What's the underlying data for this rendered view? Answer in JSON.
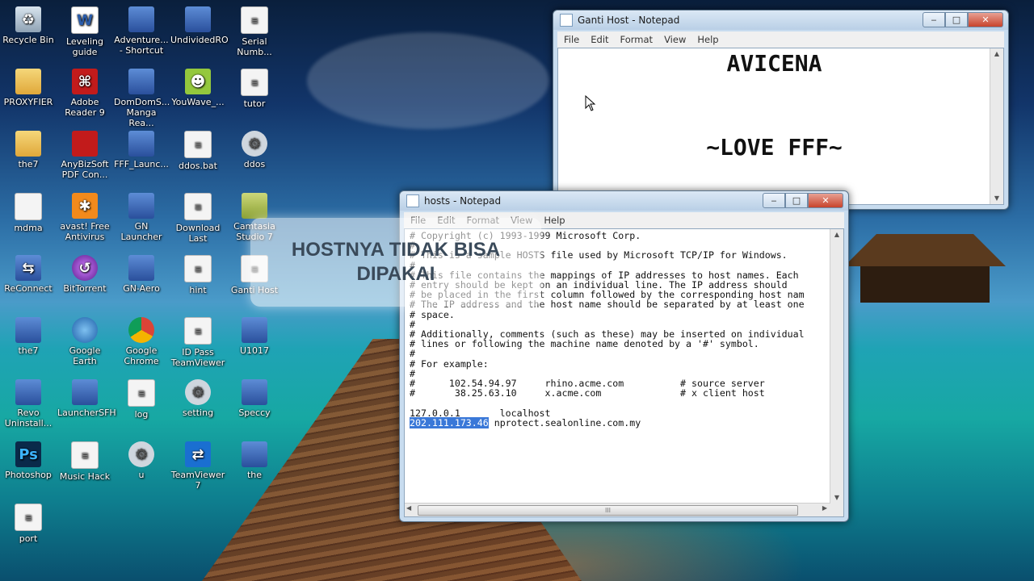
{
  "desktop": {
    "icons": [
      {
        "label": "Recycle Bin",
        "icon": "recycle-bin-icon"
      },
      {
        "label": "Leveling guide",
        "icon": "word-document-icon"
      },
      {
        "label": "Adventure... - Shortcut",
        "icon": "shortcut-icon"
      },
      {
        "label": "UndividedRO",
        "icon": "app-icon"
      },
      {
        "label": "Serial Numb...",
        "icon": "document-icon"
      },
      {
        "label": "PROXYFIER",
        "icon": "folder-icon"
      },
      {
        "label": "Adobe Reader 9",
        "icon": "pdf-icon"
      },
      {
        "label": "DomDomS... Manga Rea...",
        "icon": "app-icon"
      },
      {
        "label": "YouWave_...",
        "icon": "android-icon"
      },
      {
        "label": "tutor",
        "icon": "document-icon"
      },
      {
        "label": "the7",
        "icon": "folder-icon"
      },
      {
        "label": "AnyBizSoft PDF Con...",
        "icon": "pdf-converter-icon"
      },
      {
        "label": "FFF_Launc...",
        "icon": "app-icon"
      },
      {
        "label": "ddos.bat",
        "icon": "document-icon"
      },
      {
        "label": "ddos",
        "icon": "settings-icon"
      },
      {
        "label": "mdma",
        "icon": "usb-icon"
      },
      {
        "label": "avast! Free Antivirus",
        "icon": "avast-icon"
      },
      {
        "label": "GN Launcher",
        "icon": "app-icon"
      },
      {
        "label": "Download Last",
        "icon": "document-icon"
      },
      {
        "label": "Camtasia Studio 7",
        "icon": "camtasia-icon"
      },
      {
        "label": "ReConnect",
        "icon": "network-icon"
      },
      {
        "label": "BitTorrent",
        "icon": "bittorrent-icon"
      },
      {
        "label": "GN-Aero",
        "icon": "app-icon"
      },
      {
        "label": "hint",
        "icon": "document-icon"
      },
      {
        "label": "Ganti Host",
        "icon": "document-icon"
      },
      {
        "label": "the7",
        "icon": "shortcut-icon"
      },
      {
        "label": "Google Earth",
        "icon": "google-earth-icon"
      },
      {
        "label": "Google Chrome",
        "icon": "chrome-icon"
      },
      {
        "label": "ID Pass TeamViewer",
        "icon": "document-icon"
      },
      {
        "label": "U1017",
        "icon": "app-icon"
      },
      {
        "label": "Revo Uninstall...",
        "icon": "revo-icon"
      },
      {
        "label": "LauncherSFH",
        "icon": "app-icon"
      },
      {
        "label": "log",
        "icon": "document-icon"
      },
      {
        "label": "setting",
        "icon": "gear-icon"
      },
      {
        "label": "Speccy",
        "icon": "speccy-icon"
      },
      {
        "label": "Photoshop",
        "icon": "photoshop-icon"
      },
      {
        "label": "Music Hack",
        "icon": "document-icon"
      },
      {
        "label": "u",
        "icon": "gear-icon"
      },
      {
        "label": "TeamViewer 7",
        "icon": "teamviewer-icon"
      },
      {
        "label": "the",
        "icon": "shortcut-icon"
      },
      {
        "label": "port",
        "icon": "document-icon"
      }
    ]
  },
  "ganti_window": {
    "title": "Ganti Host - Notepad",
    "menu": [
      "File",
      "Edit",
      "Format",
      "View",
      "Help"
    ],
    "lines": [
      "AVICENA",
      "~LOVE FFF~"
    ],
    "buttons": {
      "minimize": "‒",
      "maximize": "□",
      "close": "✕"
    }
  },
  "hosts_window": {
    "title": "hosts - Notepad",
    "menu": [
      "File",
      "Edit",
      "Format",
      "View",
      "Help"
    ],
    "buttons": {
      "minimize": "‒",
      "maximize": "□",
      "close": "✕"
    },
    "lines": [
      "# Copyright (c) 1993-1999 Microsoft Corp.",
      "#",
      "# This is a sample HOSTS file used by Microsoft TCP/IP for Windows.",
      "#",
      "# This file contains the mappings of IP addresses to host names. Each",
      "# entry should be kept on an individual line. The IP address should",
      "# be placed in the first column followed by the corresponding host nam",
      "# The IP address and the host name should be separated by at least one",
      "# space.",
      "#",
      "# Additionally, comments (such as these) may be inserted on individual",
      "# lines or following the machine name denoted by a '#' symbol.",
      "#",
      "# For example:",
      "#",
      "#      102.54.94.97     rhino.acme.com          # source server",
      "#       38.25.63.10     x.acme.com              # x client host",
      "",
      "127.0.0.1       localhost"
    ],
    "last_line_selected": "202.111.173.46",
    "last_line_rest": " nprotect.sealonline.com.my",
    "hscroll_glyph": "III"
  },
  "overlay": {
    "text": "HOSTNYA TIDAK BISA DIPAKAI"
  }
}
